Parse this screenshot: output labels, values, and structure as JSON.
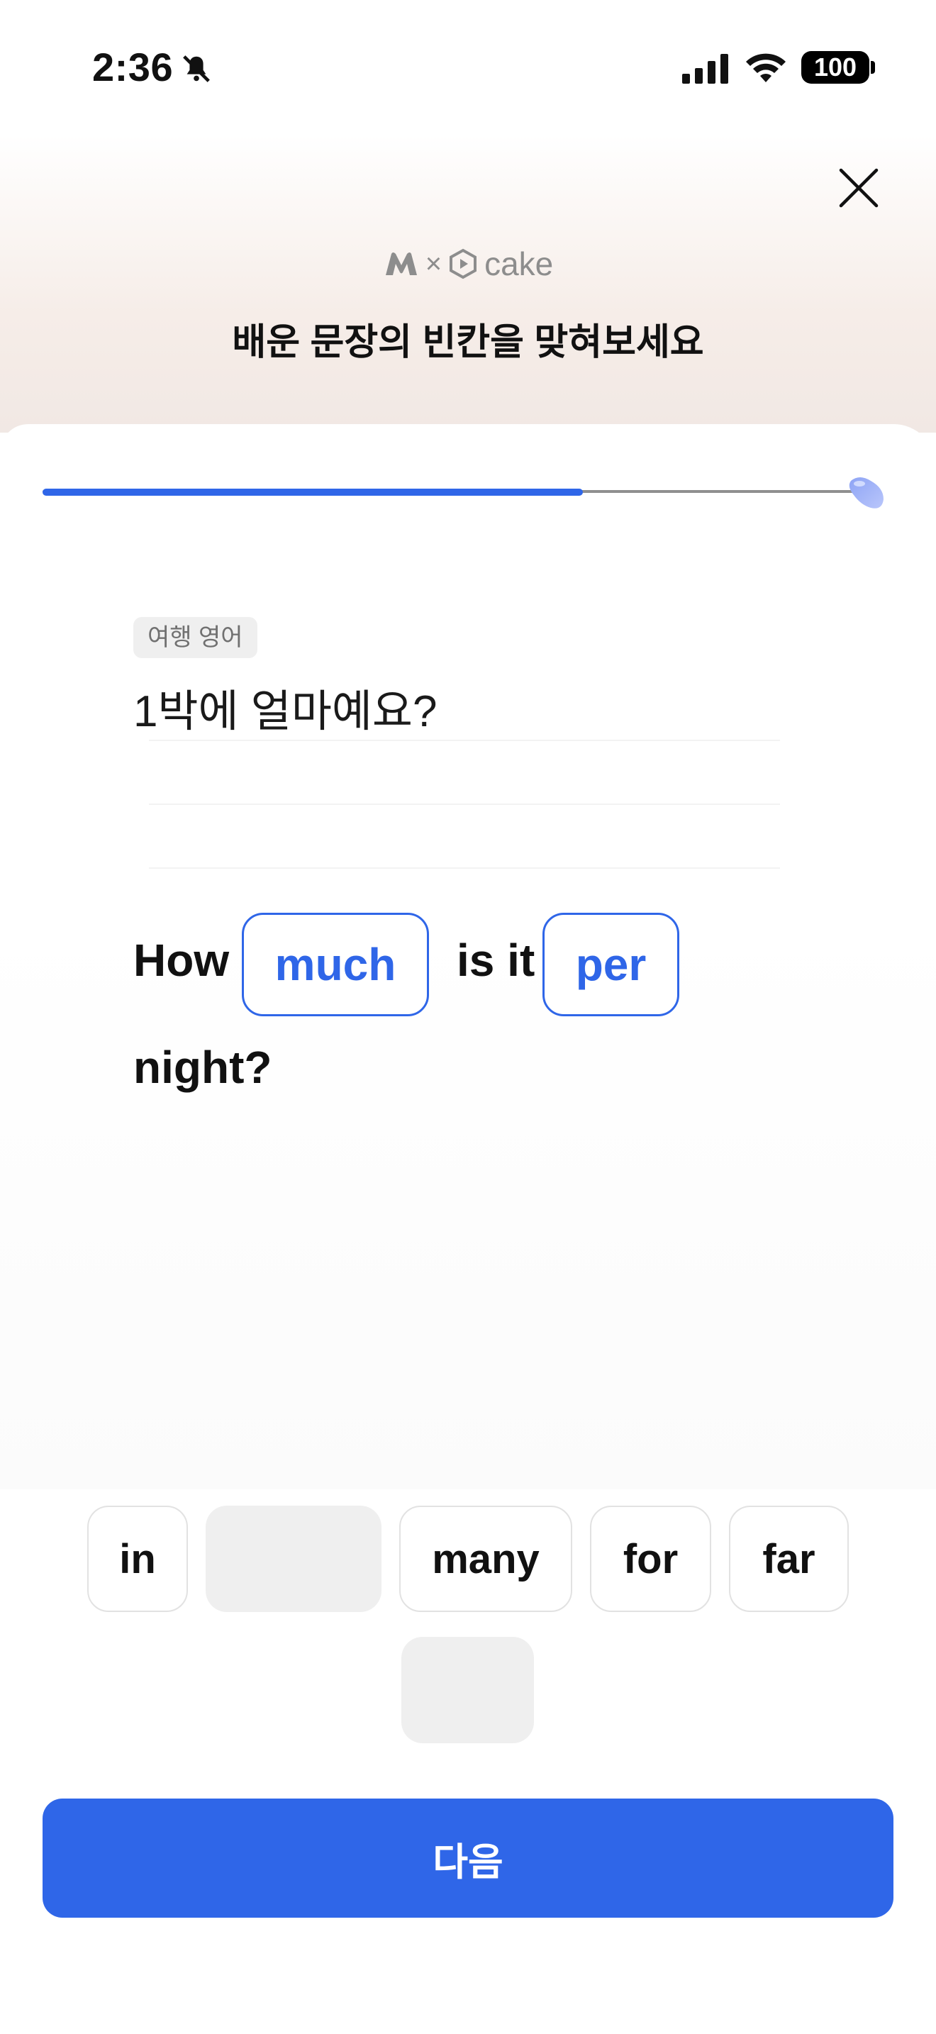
{
  "status_bar": {
    "time": "2:36",
    "battery": "100"
  },
  "header": {
    "brand_left": "M",
    "brand_separator": "×",
    "brand_right": "cake",
    "title": "배운 문장의 빈칸을 맞혀보세요"
  },
  "progress": {
    "fraction": 0.66
  },
  "question": {
    "category": "여행 영어",
    "korean": "1박에 얼마예요?",
    "words": [
      "How",
      "is it",
      "night?"
    ],
    "blanks": [
      "much",
      "per"
    ]
  },
  "choices": [
    "in",
    "many",
    "for",
    "far"
  ],
  "footer": {
    "next_label": "다음"
  },
  "colors": {
    "accent": "#2f66e8",
    "tag_bg": "#efefef"
  }
}
